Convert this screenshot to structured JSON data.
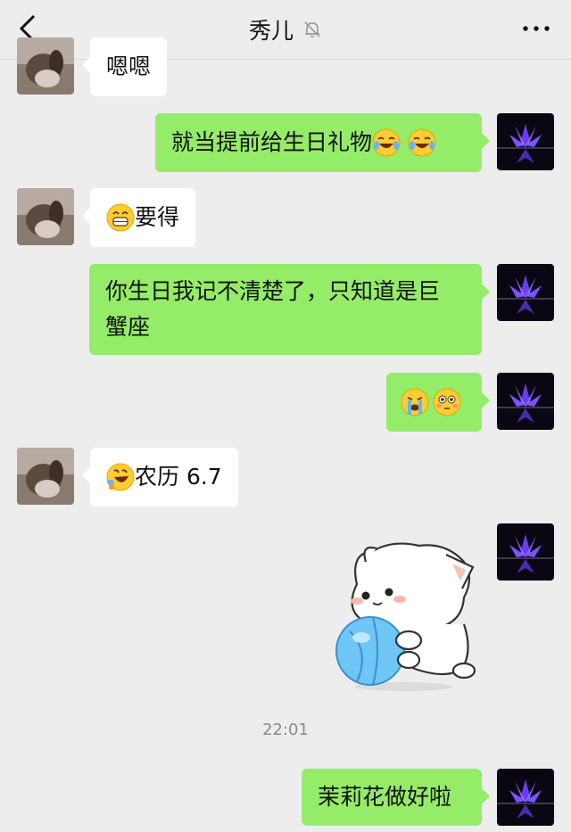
{
  "header": {
    "title": "秀儿",
    "mute_icon": "bell-muted-icon",
    "back_icon": "back-chevron-icon",
    "more_icon": "more-dots-icon"
  },
  "messages": [
    {
      "side": "left",
      "text": "嗯嗯"
    },
    {
      "side": "right",
      "text": "就当提前给生日礼物",
      "emojis": [
        "laugh-tears-emoji",
        "laugh-tears-emoji"
      ]
    },
    {
      "side": "left",
      "text": "要得",
      "lead_emoji": "grin-emoji"
    },
    {
      "side": "right",
      "line1": "你生日我记不清楚了，只知道是巨",
      "line2": "蟹座"
    },
    {
      "side": "right",
      "emojis": [
        "crying-emoji",
        "flushed-emoji"
      ]
    },
    {
      "side": "left",
      "text": "农历 6.7",
      "lead_emoji": "rofl-emoji"
    },
    {
      "side": "right",
      "sticker": "cat-with-ball-sticker"
    },
    {
      "side": "right",
      "text": "茉莉花做好啦"
    }
  ],
  "timestamp": "22:01",
  "colors": {
    "background": "#ededed",
    "sent_bubble": "#95ec69",
    "received_bubble": "#ffffff"
  }
}
